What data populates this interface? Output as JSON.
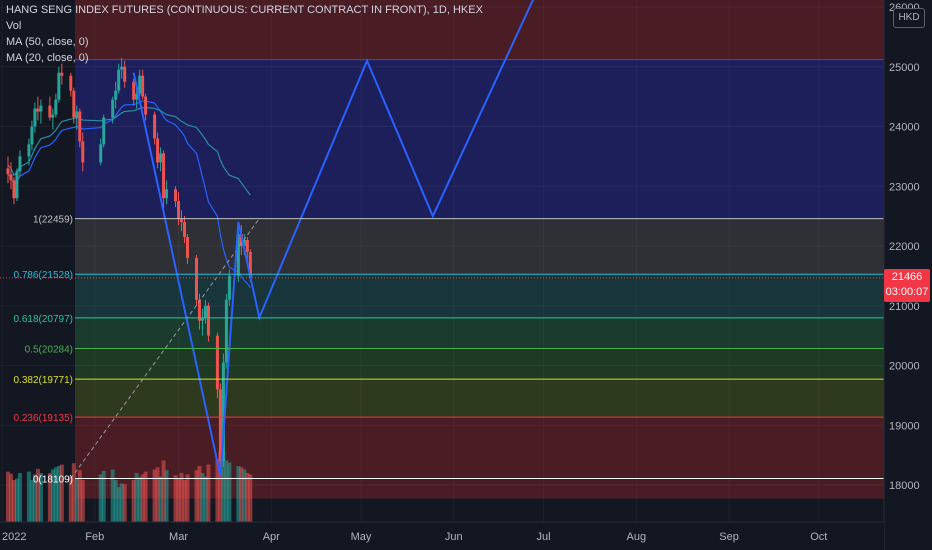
{
  "legend": {
    "title": "HANG SENG INDEX FUTURES (CONTINUOUS: CURRENT CONTRACT IN FRONT), 1D, HKEX",
    "vol": "Vol",
    "ma50": "MA (50, close, 0)",
    "ma20": "MA (20, close, 0)"
  },
  "currency": "HKD",
  "last_price": {
    "value": "21466",
    "countdown": "03:00:07"
  },
  "colors": {
    "background": "#131722",
    "up": "#26a69a",
    "down": "#ef5350",
    "pattern_line": "#2962ff",
    "ma50": "#2a8ca8",
    "axis_text": "#b2b5be"
  },
  "chart_data": {
    "type": "candlestick",
    "x_tick_labels": [
      "2022",
      "Feb",
      "Mar",
      "Apr",
      "May",
      "Jun",
      "Jul",
      "Aug",
      "Sep",
      "Oct"
    ],
    "y_tick_labels": [
      "18000",
      "19000",
      "20000",
      "21000",
      "22000",
      "23000",
      "24000",
      "25000",
      "26000"
    ],
    "ylim": [
      17500,
      26200
    ],
    "fib_levels": [
      {
        "label": "0(18109)",
        "level": 0,
        "value": 18109,
        "color": "#ffffff",
        "fill": "#4a1c24"
      },
      {
        "label": "0.236(19135)",
        "level": 0.236,
        "value": 19135,
        "color": "#f23645",
        "fill": "#2e3a1e"
      },
      {
        "label": "0.382(19771)",
        "level": 0.382,
        "value": 19771,
        "color": "#d9e024",
        "fill": "#1e3a24"
      },
      {
        "label": "0.5(20284)",
        "level": 0.5,
        "value": 20284,
        "color": "#4caf50",
        "fill": "#1a3b2e"
      },
      {
        "label": "0.618(20797)",
        "level": 0.618,
        "value": 20797,
        "color": "#26c6a0",
        "fill": "#17353b"
      },
      {
        "label": "0.786(21528)",
        "level": 0.786,
        "value": 21528,
        "color": "#2dbad6",
        "fill": "#2e3035"
      },
      {
        "label": "1(22459)",
        "level": 1,
        "value": 22459,
        "color": "#c0c0c0",
        "fill": "#1d1f5a"
      }
    ],
    "fib_upper_band": {
      "from": 22459,
      "to": 25120,
      "fill": "#1d1f5a",
      "color": "#3f49c5"
    },
    "fib_top_band": {
      "from": 25120,
      "to": 26200,
      "fill": "#4a1c24"
    },
    "pattern_points": [
      {
        "date": "2022-02-14",
        "price": 24900
      },
      {
        "date": "2022-03-15",
        "price": 18150
      },
      {
        "date": "2022-03-21",
        "price": 22400
      },
      {
        "date": "2022-03-28",
        "price": 20800
      },
      {
        "date": "2022-05-03",
        "price": 25100
      },
      {
        "date": "2022-05-25",
        "price": 22500
      },
      {
        "date": "2022-07-01",
        "price": 26500
      }
    ],
    "candles": [
      {
        "date": "2022-01-03",
        "o": 23300,
        "h": 23500,
        "l": 23050,
        "c": 23200
      },
      {
        "date": "2022-01-04",
        "o": 23200,
        "h": 23400,
        "l": 22950,
        "c": 23100
      },
      {
        "date": "2022-01-05",
        "o": 23100,
        "h": 23150,
        "l": 22700,
        "c": 22800
      },
      {
        "date": "2022-01-06",
        "o": 22800,
        "h": 23300,
        "l": 22750,
        "c": 23250
      },
      {
        "date": "2022-01-07",
        "o": 23250,
        "h": 23600,
        "l": 23150,
        "c": 23500
      },
      {
        "date": "2022-01-10",
        "o": 23500,
        "h": 23800,
        "l": 23350,
        "c": 23700
      },
      {
        "date": "2022-01-11",
        "o": 23700,
        "h": 24100,
        "l": 23600,
        "c": 24000
      },
      {
        "date": "2022-01-12",
        "o": 24000,
        "h": 24400,
        "l": 23900,
        "c": 24300
      },
      {
        "date": "2022-01-13",
        "o": 24300,
        "h": 24500,
        "l": 24100,
        "c": 24250
      },
      {
        "date": "2022-01-14",
        "o": 24250,
        "h": 24450,
        "l": 24050,
        "c": 24350
      },
      {
        "date": "2022-01-17",
        "o": 24350,
        "h": 24500,
        "l": 24100,
        "c": 24150
      },
      {
        "date": "2022-01-18",
        "o": 24150,
        "h": 24300,
        "l": 23950,
        "c": 24200
      },
      {
        "date": "2022-01-19",
        "o": 24200,
        "h": 24550,
        "l": 24150,
        "c": 24450
      },
      {
        "date": "2022-01-20",
        "o": 24450,
        "h": 25000,
        "l": 24400,
        "c": 24900
      },
      {
        "date": "2022-01-21",
        "o": 24900,
        "h": 25050,
        "l": 24700,
        "c": 24850
      },
      {
        "date": "2022-01-24",
        "o": 24850,
        "h": 24900,
        "l": 24500,
        "c": 24600
      },
      {
        "date": "2022-01-25",
        "o": 24600,
        "h": 24650,
        "l": 24050,
        "c": 24150
      },
      {
        "date": "2022-01-26",
        "o": 24150,
        "h": 24350,
        "l": 23950,
        "c": 24250
      },
      {
        "date": "2022-01-27",
        "o": 24250,
        "h": 24300,
        "l": 23650,
        "c": 23750
      },
      {
        "date": "2022-01-28",
        "o": 23750,
        "h": 23900,
        "l": 23250,
        "c": 23400
      },
      {
        "date": "2022-02-03",
        "o": 23400,
        "h": 23800,
        "l": 23350,
        "c": 23700
      },
      {
        "date": "2022-02-04",
        "o": 23700,
        "h": 24200,
        "l": 23650,
        "c": 24150
      },
      {
        "date": "2022-02-07",
        "o": 24150,
        "h": 24500,
        "l": 24050,
        "c": 24450
      },
      {
        "date": "2022-02-08",
        "o": 24450,
        "h": 24750,
        "l": 24300,
        "c": 24600
      },
      {
        "date": "2022-02-09",
        "o": 24600,
        "h": 25050,
        "l": 24550,
        "c": 24950
      },
      {
        "date": "2022-02-10",
        "o": 24950,
        "h": 25150,
        "l": 24800,
        "c": 25000
      },
      {
        "date": "2022-02-11",
        "o": 25000,
        "h": 25100,
        "l": 24650,
        "c": 24750
      },
      {
        "date": "2022-02-14",
        "o": 24750,
        "h": 24800,
        "l": 24350,
        "c": 24450
      },
      {
        "date": "2022-02-15",
        "o": 24450,
        "h": 24650,
        "l": 24300,
        "c": 24550
      },
      {
        "date": "2022-02-16",
        "o": 24550,
        "h": 24950,
        "l": 24500,
        "c": 24850
      },
      {
        "date": "2022-02-17",
        "o": 24850,
        "h": 24950,
        "l": 24450,
        "c": 24500
      },
      {
        "date": "2022-02-18",
        "o": 24500,
        "h": 24550,
        "l": 24100,
        "c": 24200
      },
      {
        "date": "2022-02-21",
        "o": 24200,
        "h": 24250,
        "l": 23700,
        "c": 23800
      },
      {
        "date": "2022-02-22",
        "o": 23800,
        "h": 23900,
        "l": 23300,
        "c": 23400
      },
      {
        "date": "2022-02-23",
        "o": 23400,
        "h": 23650,
        "l": 23250,
        "c": 23550
      },
      {
        "date": "2022-02-24",
        "o": 23550,
        "h": 23600,
        "l": 22600,
        "c": 22800
      },
      {
        "date": "2022-02-25",
        "o": 22800,
        "h": 23100,
        "l": 22700,
        "c": 22950
      },
      {
        "date": "2022-02-28",
        "o": 22950,
        "h": 23000,
        "l": 22650,
        "c": 22750
      },
      {
        "date": "2022-03-01",
        "o": 22750,
        "h": 22900,
        "l": 22350,
        "c": 22450
      },
      {
        "date": "2022-03-02",
        "o": 22450,
        "h": 22600,
        "l": 22250,
        "c": 22400
      },
      {
        "date": "2022-03-03",
        "o": 22400,
        "h": 22500,
        "l": 22050,
        "c": 22150
      },
      {
        "date": "2022-03-04",
        "o": 22150,
        "h": 22200,
        "l": 21700,
        "c": 21800
      },
      {
        "date": "2022-03-07",
        "o": 21800,
        "h": 21850,
        "l": 21000,
        "c": 21100
      },
      {
        "date": "2022-03-08",
        "o": 21100,
        "h": 21200,
        "l": 20600,
        "c": 20750
      },
      {
        "date": "2022-03-09",
        "o": 20750,
        "h": 20950,
        "l": 20500,
        "c": 20800
      },
      {
        "date": "2022-03-10",
        "o": 20800,
        "h": 21100,
        "l": 20700,
        "c": 21000
      },
      {
        "date": "2022-03-11",
        "o": 21000,
        "h": 21050,
        "l": 20400,
        "c": 20500
      },
      {
        "date": "2022-03-14",
        "o": 20500,
        "h": 20550,
        "l": 19450,
        "c": 19600
      },
      {
        "date": "2022-03-15",
        "o": 19600,
        "h": 19700,
        "l": 18150,
        "c": 18400
      },
      {
        "date": "2022-03-16",
        "o": 18400,
        "h": 20200,
        "l": 18300,
        "c": 20050
      },
      {
        "date": "2022-03-17",
        "o": 20050,
        "h": 21200,
        "l": 19950,
        "c": 21100
      },
      {
        "date": "2022-03-18",
        "o": 21100,
        "h": 21600,
        "l": 21000,
        "c": 21500
      },
      {
        "date": "2022-03-21",
        "o": 21500,
        "h": 22400,
        "l": 21400,
        "c": 22200
      },
      {
        "date": "2022-03-22",
        "o": 22200,
        "h": 22350,
        "l": 21850,
        "c": 22000
      },
      {
        "date": "2022-03-23",
        "o": 22000,
        "h": 22200,
        "l": 21850,
        "c": 22100
      },
      {
        "date": "2022-03-24",
        "o": 22100,
        "h": 22150,
        "l": 21750,
        "c": 21900
      },
      {
        "date": "2022-03-25",
        "o": 21900,
        "h": 21950,
        "l": 21400,
        "c": 21466
      }
    ],
    "volumes": [
      72,
      69,
      60,
      62,
      70,
      72,
      60,
      68,
      76,
      70,
      70,
      75,
      78,
      80,
      82,
      65,
      84,
      62,
      74,
      60,
      68,
      73,
      75,
      60,
      50,
      55,
      54,
      60,
      70,
      64,
      68,
      72,
      75,
      78,
      65,
      88,
      74,
      67,
      62,
      70,
      60,
      68,
      74,
      80,
      70,
      65,
      82,
      90,
      100,
      100,
      88,
      85,
      80,
      78,
      75,
      70,
      68
    ]
  }
}
